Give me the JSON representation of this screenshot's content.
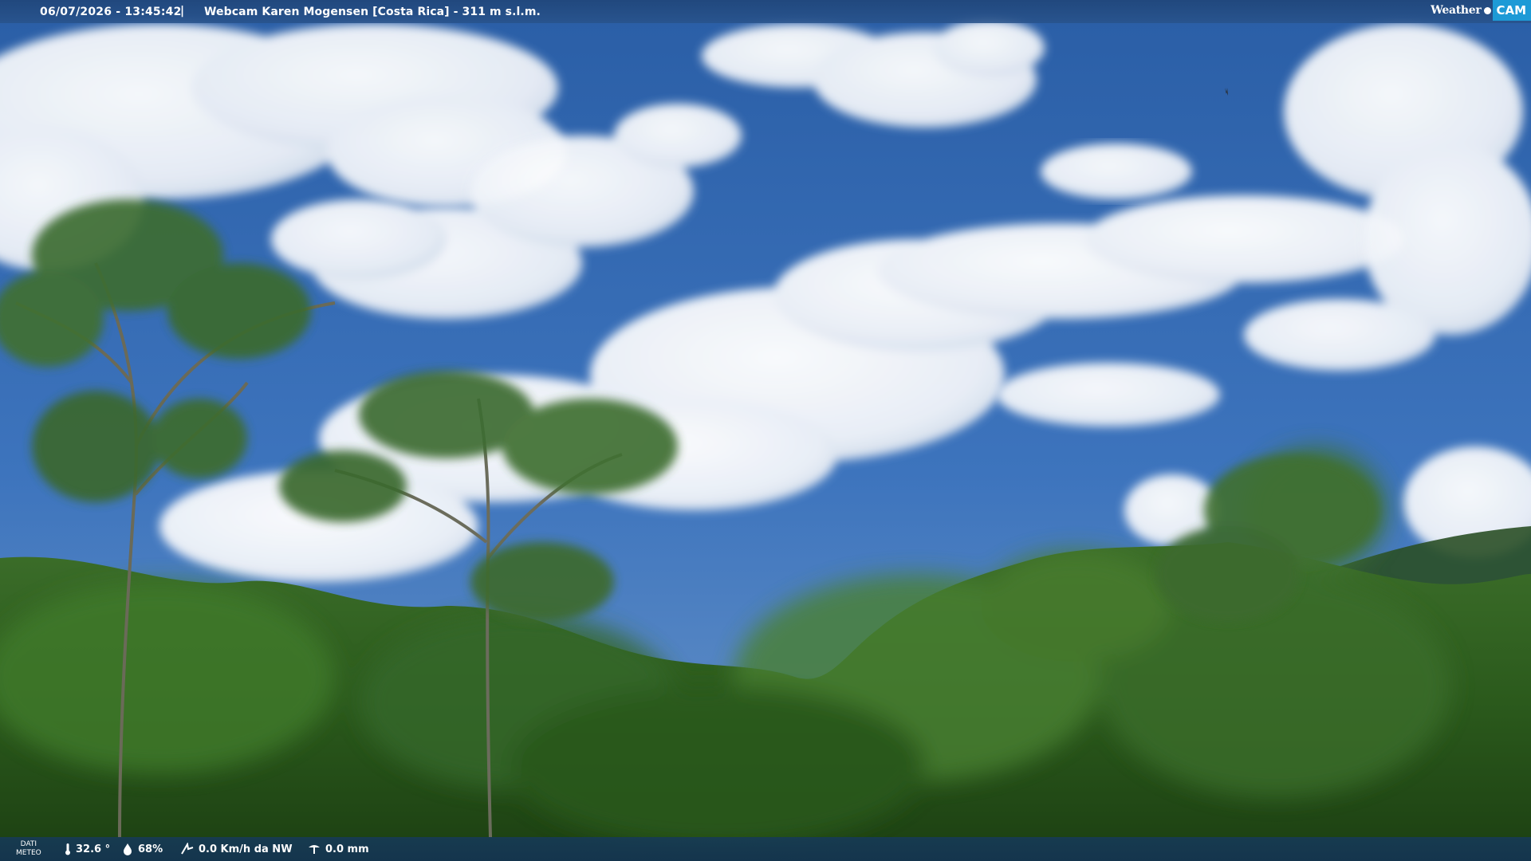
{
  "header": {
    "timestamp": "06/07/2026 - 13:45:42",
    "separator": "|",
    "title": "Webcam Karen Mogensen [Costa Rica]  - 311 m s.l.m."
  },
  "brand": {
    "weather": "Weather",
    "cam": "CAM",
    "accent_color": "#1d9ad6"
  },
  "footer": {
    "dati_line1": "DATI",
    "dati_line2": "METEO",
    "temperature": "32.6 °",
    "humidity": "68%",
    "wind": "0.0 Km/h da NW",
    "rain": "0.0 mm",
    "icons": [
      "thermometer-icon",
      "humidity-drop-icon",
      "wind-icon",
      "rain-gauge-icon"
    ]
  },
  "scene": {
    "sky_color": "#2f66b0",
    "foliage_color": "#2c5a1e"
  }
}
